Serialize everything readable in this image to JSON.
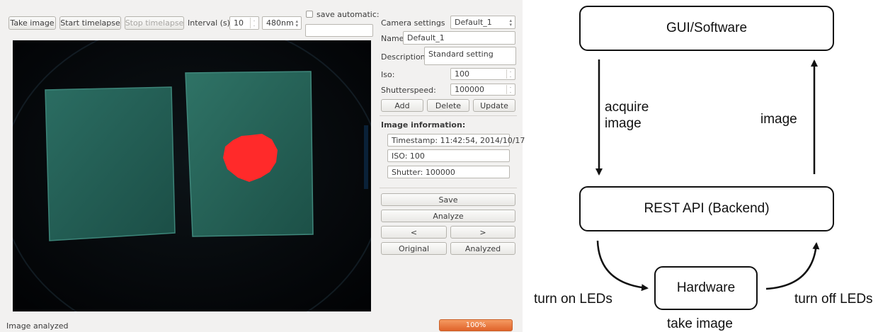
{
  "toolbar": {
    "take_image": "Take image",
    "start_timelapse": "Start timelapse",
    "stop_timelapse": "Stop timelapse",
    "interval_label": "Interval (s)",
    "interval_value": "10",
    "wavelength": "480nm",
    "save_automatic_label": "save automatic:",
    "save_automatic_checked": false,
    "save_automatic_value": ""
  },
  "camera_settings": {
    "label": "Camera settings",
    "selected_preset": "Default_1",
    "name_label": "Name:",
    "name_value": "Default_1",
    "description_label": "Description:",
    "description_value": "Standard setting",
    "iso_label": "Iso:",
    "iso_value": "100",
    "shutterspeed_label": "Shutterspeed:",
    "shutterspeed_value": "100000",
    "add": "Add",
    "delete": "Delete",
    "update": "Update"
  },
  "image_information": {
    "heading": "Image information:",
    "timestamp": "Timestamp: 11:42:54, 2014/10/17",
    "iso": "ISO: 100",
    "shutter": "Shutter: 100000"
  },
  "actions": {
    "save": "Save",
    "analyze": "Analyze",
    "prev": "<",
    "next": ">",
    "original": "Original",
    "analyzed": "Analyzed"
  },
  "status": {
    "message": "Image analyzed",
    "progress_text": "100%",
    "progress_fraction": 1.0
  },
  "colors": {
    "progress": "#e86f35",
    "highlight": "#ff2a2a",
    "gel": "#1f5b52"
  },
  "diagram": {
    "gui": "GUI/Software",
    "rest": "REST API (Backend)",
    "hardware": "Hardware",
    "acquire_line1": "acquire",
    "acquire_line2": "image",
    "image": "image",
    "turn_on": "turn on LEDs",
    "turn_off": "turn off LEDs",
    "take_image": "take image"
  }
}
